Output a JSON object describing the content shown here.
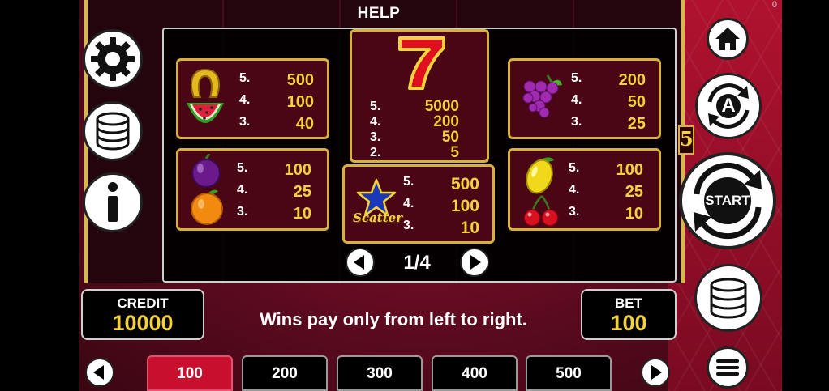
{
  "header": {
    "title": "HELP",
    "corner_counter": "0"
  },
  "paytable": {
    "page_indicator": "1/4",
    "cards": [
      {
        "id": "horseshoe-watermelon",
        "symbols": [
          "horseshoe",
          "watermelon"
        ],
        "rows": [
          {
            "n": "5.",
            "v": "500"
          },
          {
            "n": "4.",
            "v": "100"
          },
          {
            "n": "3.",
            "v": "40"
          }
        ]
      },
      {
        "id": "seven",
        "symbols": [
          "seven"
        ],
        "rows": [
          {
            "n": "5.",
            "v": "5000"
          },
          {
            "n": "4.",
            "v": "200"
          },
          {
            "n": "3.",
            "v": "50"
          },
          {
            "n": "2.",
            "v": "5"
          }
        ]
      },
      {
        "id": "grapes",
        "symbols": [
          "grapes"
        ],
        "rows": [
          {
            "n": "5.",
            "v": "200"
          },
          {
            "n": "4.",
            "v": "50"
          },
          {
            "n": "3.",
            "v": "25"
          }
        ]
      },
      {
        "id": "plum-orange",
        "symbols": [
          "plum",
          "orange"
        ],
        "rows": [
          {
            "n": "5.",
            "v": "100"
          },
          {
            "n": "4.",
            "v": "25"
          },
          {
            "n": "3.",
            "v": "10"
          }
        ]
      },
      {
        "id": "scatter",
        "symbols": [
          "star"
        ],
        "scatter_label": "Scatter",
        "rows": [
          {
            "n": "5.",
            "v": "500"
          },
          {
            "n": "4.",
            "v": "100"
          },
          {
            "n": "3.",
            "v": "10"
          }
        ]
      },
      {
        "id": "lemon-cherry",
        "symbols": [
          "lemon",
          "cherry"
        ],
        "rows": [
          {
            "n": "5.",
            "v": "100"
          },
          {
            "n": "4.",
            "v": "25"
          },
          {
            "n": "3.",
            "v": "10"
          }
        ]
      }
    ]
  },
  "credit": {
    "label": "CREDIT",
    "value": "10000"
  },
  "bet": {
    "label": "BET",
    "value": "100"
  },
  "message": "Wins pay only from left to right.",
  "bet_options": {
    "values": [
      "100",
      "200",
      "300",
      "400",
      "500"
    ],
    "selected": "100"
  },
  "right_controls": {
    "start_label": "START",
    "autoplay_label": "A",
    "line_number": "5"
  },
  "icons": [
    "gear-icon",
    "coins-icon",
    "info-icon",
    "home-icon",
    "autoplay-icon",
    "start-icon",
    "menu-icon",
    "arrow-left-icon",
    "arrow-right-icon"
  ],
  "colors": {
    "gold": "#f4d23c",
    "card_bg": "#4a0614",
    "selected_bet": "#c8102e"
  }
}
